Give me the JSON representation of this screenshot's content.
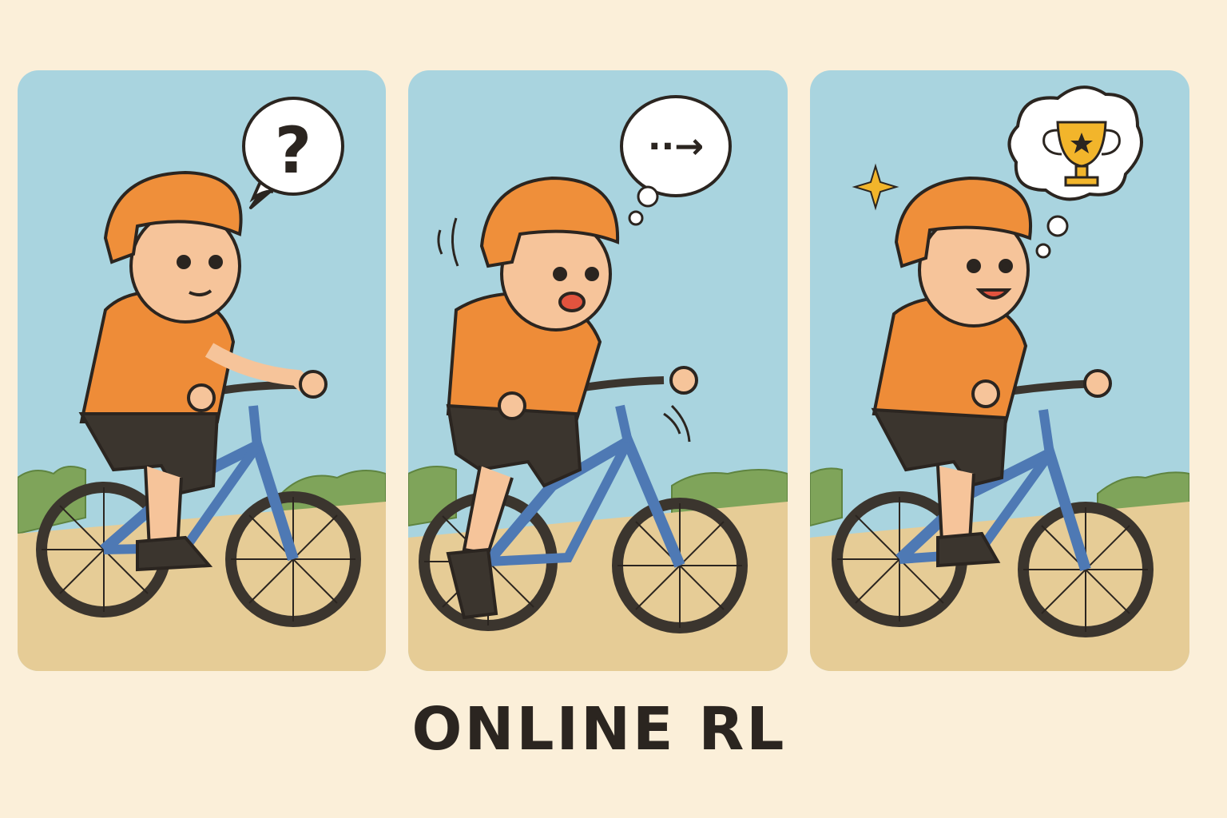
{
  "caption": "ONLINE RL",
  "panels": [
    {
      "thought_icon": "question-mark-icon",
      "thought_text": "?"
    },
    {
      "thought_icon": "dots-arrow-icon",
      "thought_text": "··→"
    },
    {
      "thought_icon": "trophy-icon",
      "thought_text": ""
    }
  ],
  "colors": {
    "background": "#fbefd9",
    "sky": "#a9d4df",
    "ground": "#e6cc96",
    "bushes": "#7fa45a",
    "helmet": "#ef8f3a",
    "shirt": "#ee8c38",
    "shorts": "#3b352e",
    "bike_frame": "#4e79b4",
    "skin": "#f6c49a",
    "outline": "#2b2520",
    "trophy": "#f2b52b"
  }
}
